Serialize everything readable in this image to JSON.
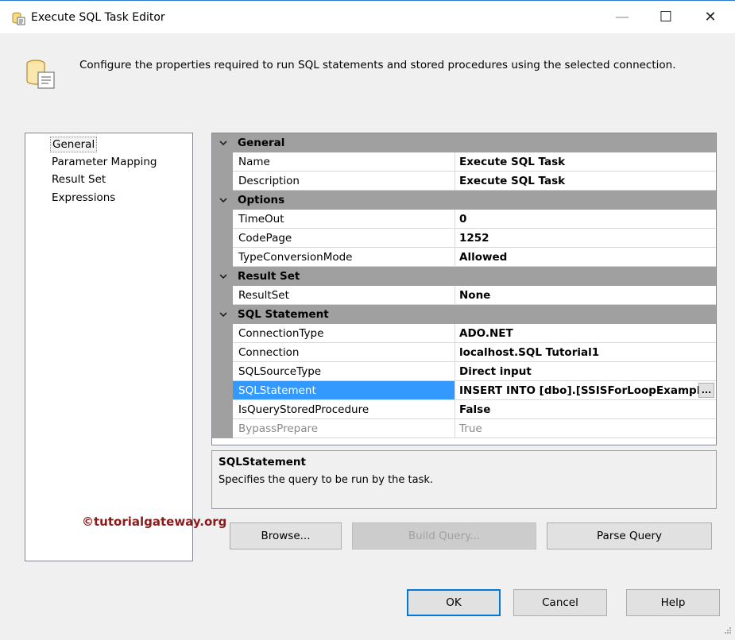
{
  "window": {
    "title": "Execute SQL Task Editor",
    "minimize": "—",
    "maximize": "☐",
    "close": "✕"
  },
  "header": {
    "description": "Configure the properties required to run SQL statements and stored procedures using the selected connection."
  },
  "nav": {
    "items": [
      "General",
      "Parameter Mapping",
      "Result Set",
      "Expressions"
    ],
    "selected": "General"
  },
  "grid": {
    "categories": [
      {
        "label": "General",
        "properties": [
          {
            "name": "Name",
            "value": "Execute SQL Task"
          },
          {
            "name": "Description",
            "value": "Execute SQL Task"
          }
        ]
      },
      {
        "label": "Options",
        "properties": [
          {
            "name": "TimeOut",
            "value": "0"
          },
          {
            "name": "CodePage",
            "value": "1252"
          },
          {
            "name": "TypeConversionMode",
            "value": "Allowed"
          }
        ]
      },
      {
        "label": "Result Set",
        "properties": [
          {
            "name": "ResultSet",
            "value": "None"
          }
        ]
      },
      {
        "label": "SQL Statement",
        "properties": [
          {
            "name": "ConnectionType",
            "value": "ADO.NET"
          },
          {
            "name": "Connection",
            "value": "localhost.SQL Tutorial1"
          },
          {
            "name": "SQLSourceType",
            "value": "Direct input"
          },
          {
            "name": "SQLStatement",
            "value": "INSERT INTO [dbo].[SSISForLoopExample]"
          },
          {
            "name": "IsQueryStoredProcedure",
            "value": "False"
          },
          {
            "name": "BypassPrepare",
            "value": "True"
          }
        ]
      }
    ],
    "ellipsis_label": "..."
  },
  "description_box": {
    "title": "SQLStatement",
    "text": "Specifies the query to be run by the task."
  },
  "watermark": "©tutorialgateway.org",
  "buttons": {
    "browse": "Browse...",
    "build_query": "Build Query...",
    "parse_query": "Parse Query",
    "ok": "OK",
    "cancel": "Cancel",
    "help": "Help"
  },
  "colors": {
    "selection": "#3399ff",
    "category_bg": "#a0a0a0",
    "window_bg": "#f0f0f0",
    "title_border": "#2b79d0"
  }
}
